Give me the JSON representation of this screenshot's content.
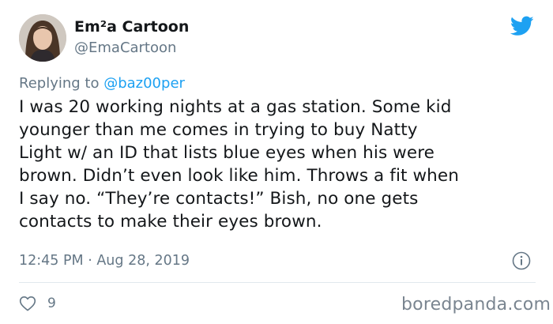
{
  "author": {
    "display_name": "Em²a Cartoon",
    "handle": "@EmaCartoon"
  },
  "reply": {
    "prefix": "Replying to ",
    "to": "@baz00per"
  },
  "body_lines": [
    "I was 20 working nights at a gas station. Some kid",
    "younger than me comes in trying to buy Natty",
    "Light w/ an ID that lists blue eyes when his were",
    "brown. Didn’t even look like him. Throws a fit when",
    "I say no. “They’re contacts!” Bish, no one gets",
    "contacts to make their eyes brown."
  ],
  "timestamp": "12:45 PM · Aug 28, 2019",
  "likes": "9",
  "watermark": "boredpanda.com",
  "icons": {
    "brand": "twitter-bird-icon",
    "info": "info-icon",
    "like": "heart-icon"
  },
  "colors": {
    "brand_blue": "#1da1f2",
    "secondary_text": "#657786",
    "divider": "#e1e8ed"
  }
}
